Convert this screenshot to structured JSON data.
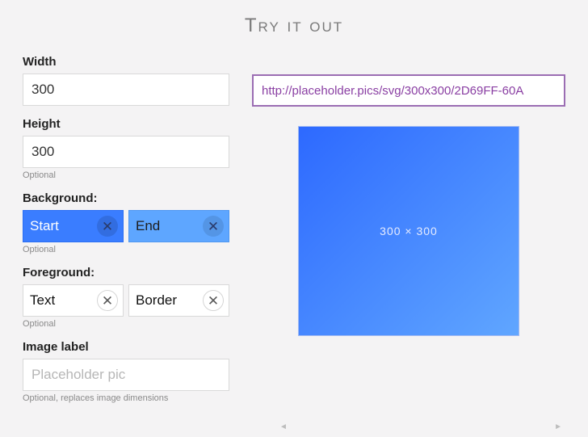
{
  "title": "Try it out",
  "fields": {
    "width": {
      "label": "Width",
      "value": "300"
    },
    "height": {
      "label": "Height",
      "value": "300",
      "hint": "Optional"
    },
    "background": {
      "label": "Background:",
      "start": {
        "label": "Start",
        "color": "#3a7dff"
      },
      "end": {
        "label": "End",
        "color": "#5ea6ff"
      },
      "hint": "Optional"
    },
    "foreground": {
      "label": "Foreground:",
      "text": {
        "label": "Text",
        "color": "#ffffff"
      },
      "border": {
        "label": "Border",
        "color": "#ffffff"
      },
      "hint": "Optional"
    },
    "image_label": {
      "label": "Image label",
      "placeholder": "Placeholder pic",
      "value": "",
      "hint": "Optional, replaces image dimensions"
    }
  },
  "close_glyph": "✕",
  "url": "http://placeholder.pics/svg/300x300/2D69FF-60A",
  "preview": {
    "label": "300 × 300",
    "gradient_start": "#2D69FF",
    "gradient_end": "#60A6FF"
  },
  "scroll": {
    "left": "◄",
    "right": "►"
  }
}
